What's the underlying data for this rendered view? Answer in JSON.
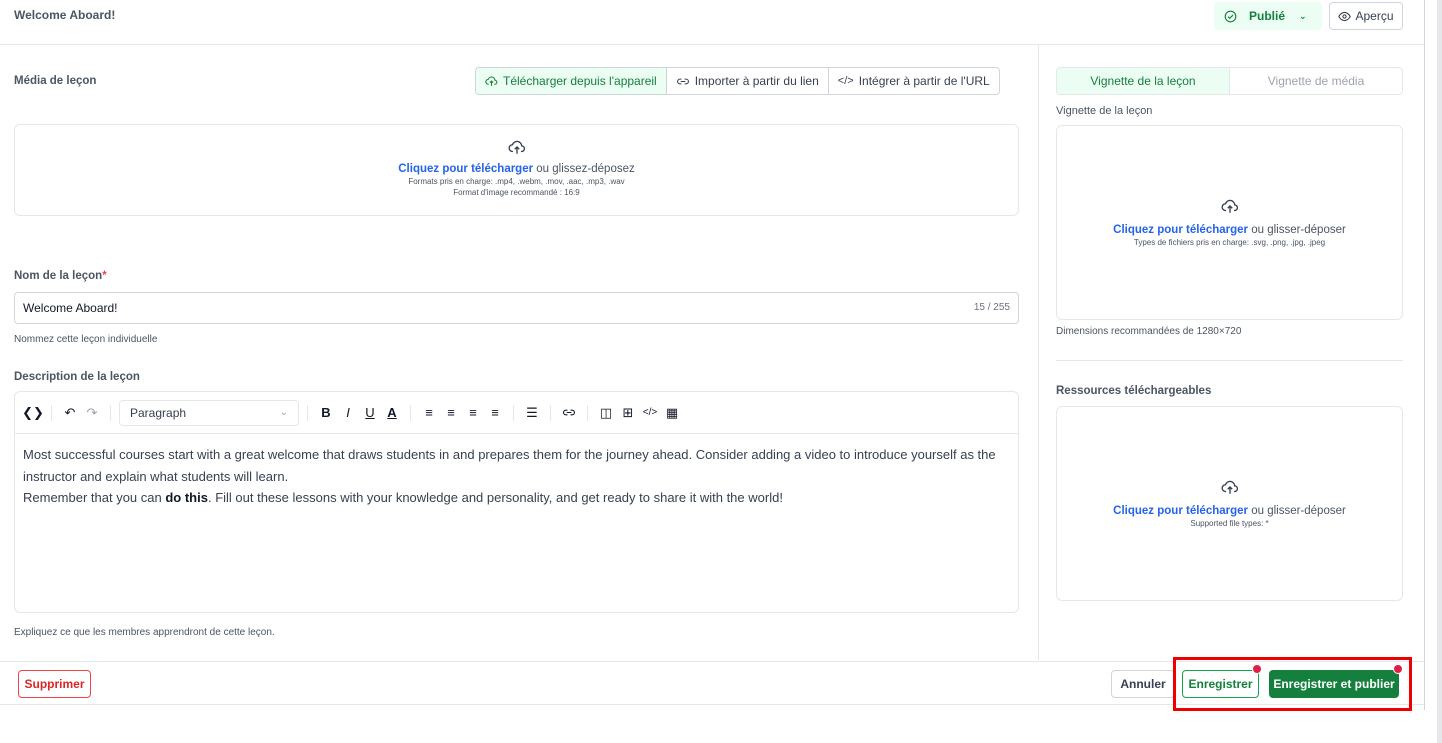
{
  "header": {
    "title": "Welcome Aboard!",
    "status_label": "Publié",
    "preview_label": "Aperçu"
  },
  "media": {
    "label": "Média de leçon",
    "tabs": [
      {
        "label": "Télécharger depuis l'appareil",
        "active": true
      },
      {
        "label": "Importer à partir du lien",
        "active": false
      },
      {
        "label": "Intégrer à partir de l'URL",
        "active": false
      }
    ],
    "dropzone": {
      "link": "Cliquez pour télécharger",
      "rest": " ou glissez-déposez",
      "formats": "Formats pris en charge: .mp4, .webm, .mov, .aac, .mp3, .wav",
      "ratio": "Format d'image recommandé : 16:9"
    }
  },
  "lesson_name": {
    "label": "Nom de la leçon",
    "required_mark": "*",
    "value": "Welcome Aboard!",
    "counter": "15 / 255",
    "help": "Nommez cette leçon individuelle"
  },
  "description": {
    "label": "Description de la leçon",
    "format_select": "Paragraph",
    "line1": "Most successful courses start with a great welcome that draws students in and prepares them for the journey ahead. Consider adding a video to introduce yourself as the instructor and explain what students will learn.",
    "line2_before": "Remember that you can ",
    "line2_bold": "do this",
    "line2_after": ". Fill out these lessons with your knowledge and personality, and get ready to share it with the world!",
    "help": "Expliquez ce que les membres apprendront de cette leçon."
  },
  "thumbnail": {
    "tabs": [
      {
        "label": "Vignette de la leçon",
        "active": true
      },
      {
        "label": "Vignette de média",
        "active": false
      }
    ],
    "label": "Vignette de la leçon",
    "link": "Cliquez pour télécharger",
    "rest": " ou glisser-déposer",
    "types": "Types de fichiers pris en charge: .svg, .png, .jpg, .jpeg",
    "help": "Dimensions recommandées de 1280×720"
  },
  "resources": {
    "label": "Ressources téléchargeables",
    "link": "Cliquez pour télécharger",
    "rest": " ou glisser-déposer",
    "types": "Supported file types: *"
  },
  "footer": {
    "delete_label": "Supprimer",
    "cancel_label": "Annuler",
    "save_label": "Enregistrer",
    "publish_label": "Enregistrer et publier"
  },
  "colors": {
    "accent_green": "#15803d",
    "link_blue": "#2563eb",
    "danger_red": "#dc2626",
    "highlight_red": "#ef0000"
  }
}
